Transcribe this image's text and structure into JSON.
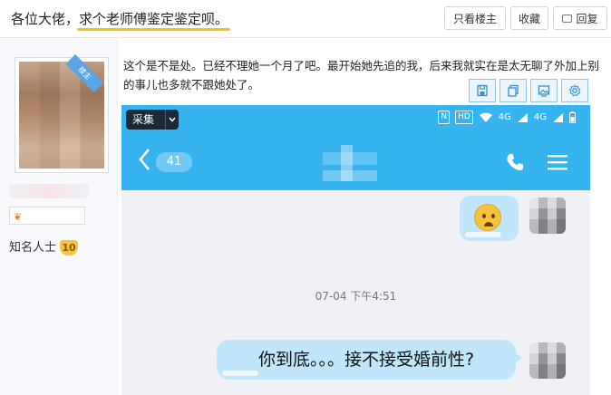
{
  "header": {
    "title_prefix": "各位大佬，",
    "title_highlight": "求个老师傅鉴定鉴定呗。",
    "buttons": {
      "only_op": "只看楼主",
      "favorite": "收藏",
      "reply": "回复"
    }
  },
  "user": {
    "floor_badge": "楼主",
    "rank_title": "知名人士",
    "level": "10"
  },
  "post": {
    "text": "这个是不是处。已经不理她一个月了吧。最开始她先追的我，后来我就实在是太无聊了外加上别的事儿也多就不跟她处了。",
    "tool_icons": [
      "save-icon",
      "copy-icon",
      "image-icon",
      "settings-icon"
    ]
  },
  "screenshot": {
    "collect_button": "采集",
    "status_icons": [
      "N",
      "HD",
      "4G",
      "4G"
    ],
    "back_count": "41",
    "timestamp": "07-04 下午4:51",
    "message": "你到底。。。接不接受婚前性?",
    "accent_color": "#35b3ef",
    "bubble_color": "#bfe6fb"
  }
}
